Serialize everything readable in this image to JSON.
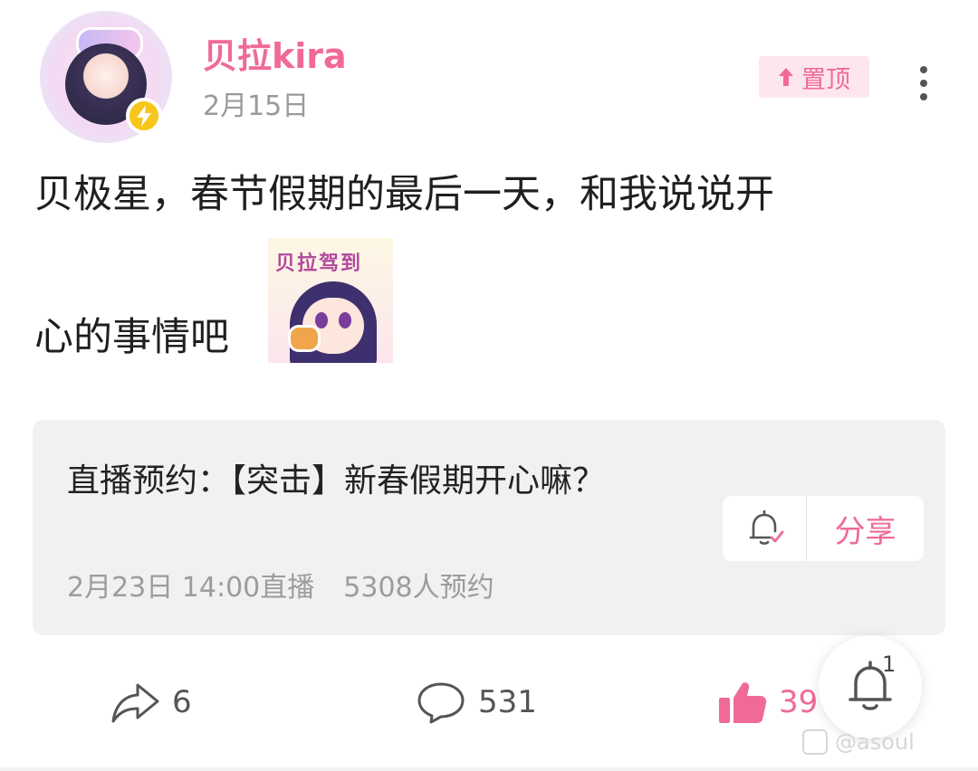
{
  "header": {
    "username": "贝拉kira",
    "date": "2月15日",
    "pin_label": "置顶"
  },
  "post": {
    "text_line1": "贝极星，春节假期的最后一天，和我说说开",
    "text_line2": "心的事情吧",
    "sticker_text": "贝拉驾到"
  },
  "live_card": {
    "title": "直播预约：【突击】新春假期开心嘛？",
    "time": "2月23日 14:00直播",
    "reservations": "5308人预约",
    "share_label": "分享"
  },
  "actions": {
    "forward_count": "6",
    "comment_count": "531",
    "like_count": "39"
  },
  "notifications": {
    "count": "1"
  },
  "watermark": "@asoul",
  "colors": {
    "accent": "#f06a97",
    "card_bg": "#f1f1f3",
    "pin_bg": "#fde6ee",
    "muted_text": "#9a9a9a"
  }
}
